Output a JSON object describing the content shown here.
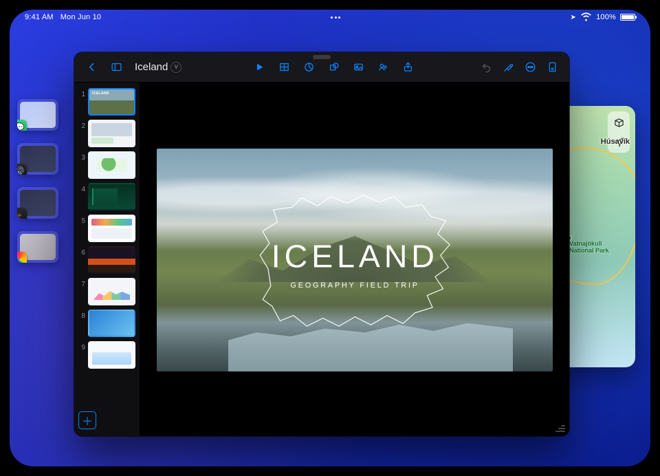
{
  "statusbar": {
    "time": "9:41 AM",
    "date": "Mon Jun 10",
    "battery_pct": "100%"
  },
  "maps": {
    "city_label": "Húsavík",
    "park_label": "Vatnajökull\nNational Park"
  },
  "keynote": {
    "doc_title": "Iceland",
    "toolbar_icons": {
      "back": "back-chevron",
      "sidebar": "sidebar-toggle",
      "play": "play",
      "table": "insert-table",
      "chart": "insert-chart",
      "shape": "insert-shape",
      "image": "insert-image",
      "collab": "collaborate",
      "share": "share",
      "undo": "undo",
      "format": "format-paintbrush",
      "more": "more-ellipsis",
      "document": "document-options"
    },
    "slides": [
      {
        "num": "1",
        "label": "ICELAND"
      },
      {
        "num": "2",
        "label": ""
      },
      {
        "num": "3",
        "label": ""
      },
      {
        "num": "4",
        "label": ""
      },
      {
        "num": "5",
        "label": ""
      },
      {
        "num": "6",
        "label": ""
      },
      {
        "num": "7",
        "label": ""
      },
      {
        "num": "8",
        "label": ""
      },
      {
        "num": "9",
        "label": ""
      }
    ],
    "canvas": {
      "title": "ICELAND",
      "subtitle": "GEOGRAPHY FIELD TRIP"
    }
  },
  "stage_manager": {
    "apps": [
      {
        "name": "messages"
      },
      {
        "name": "translate"
      },
      {
        "name": "calculator"
      },
      {
        "name": "photos"
      }
    ]
  }
}
